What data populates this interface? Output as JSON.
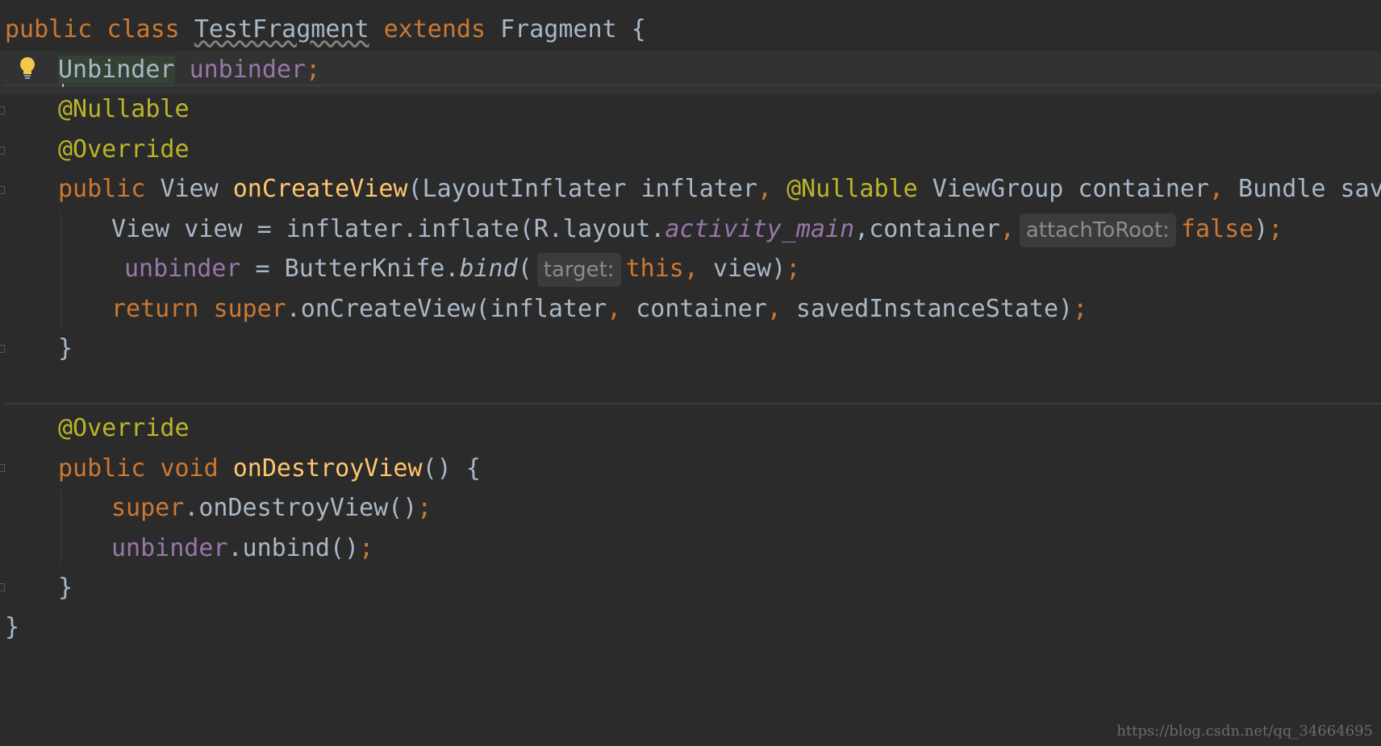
{
  "colors": {
    "background": "#2b2b2b",
    "keyword": "#cc7832",
    "annotation": "#bbb529",
    "method": "#ffc66d",
    "field": "#9876aa",
    "text": "#a9b7c6",
    "hint": "#8c8c8c"
  },
  "icons": {
    "intention": "lightbulb-icon"
  },
  "lines": {
    "l1": {
      "kw1": "public",
      "kw2": "class",
      "name": "TestFragment",
      "kw3": "extends",
      "type": "Fragment",
      "brace": " {"
    },
    "l2": {
      "type": "Unbinder",
      "field": "unbinder",
      "semi": ";"
    },
    "l3": {
      "ann": "@Nullable"
    },
    "l4": {
      "ann": "@Override"
    },
    "l5": {
      "kw": "public",
      "type": "View",
      "fn": "onCreateView",
      "p1": "(LayoutInflater inflater",
      "c1": ",",
      "ann": "@Nullable",
      "p2": "ViewGroup container",
      "c2": ",",
      "p3": "Bundle sav"
    },
    "l6": {
      "a": "View view = inflater.inflate(R.layout.",
      "field": "activity_main",
      "b": ",container",
      "c": ",",
      "hint": "attachToRoot:",
      "kw": "false",
      "d": ")",
      "semi": ";"
    },
    "l7": {
      "field": "unbinder",
      "a": " = ButterKnife.",
      "fn": "bind",
      "b": "(",
      "hint": "target:",
      "kw": "this",
      "c": ",",
      "d": " view)",
      "semi": ";"
    },
    "l8": {
      "kw": "return",
      "kw2": "super",
      "a": ".onCreateView(inflater",
      "c1": ",",
      "b": " container",
      "c2": ",",
      "d": " savedInstanceState)",
      "semi": ";"
    },
    "l9": {
      "brace": "}"
    },
    "l10": {
      "ann": "@Override"
    },
    "l11": {
      "kw": "public",
      "kw2": "void",
      "fn": "onDestroyView",
      "rest": "() {"
    },
    "l12": {
      "kw": "super",
      "a": ".onDestroyView()",
      "semi": ";"
    },
    "l13": {
      "field": "unbinder",
      "a": ".unbind()",
      "semi": ";"
    },
    "l14": {
      "brace": "}"
    },
    "l15": {
      "brace": "}"
    }
  },
  "watermark": "https://blog.csdn.net/qq_34664695"
}
